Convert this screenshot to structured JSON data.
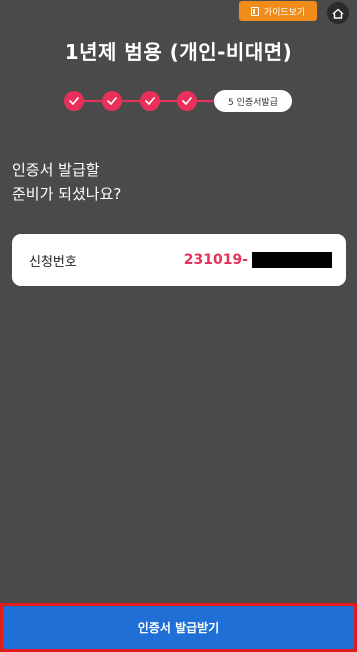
{
  "header": {
    "guide_button_label": "가이드보기",
    "title": "1년제 범용 (개인-비대면)"
  },
  "steps": {
    "completed": [
      1,
      2,
      3,
      4
    ],
    "current_label": "5 인증서발급"
  },
  "main": {
    "question_line1": "인증서 발급할",
    "question_line2": "준비가 되셨나요?"
  },
  "application": {
    "label": "신청번호",
    "number_visible": "231019-"
  },
  "footer": {
    "issue_button_label": "인증서 발급받기"
  },
  "colors": {
    "background": "#4a4a4a",
    "accent_pink": "#e8305a",
    "guide_orange": "#f08c1a",
    "primary_blue": "#1f6fd6",
    "highlight_red": "#e21b1b"
  }
}
